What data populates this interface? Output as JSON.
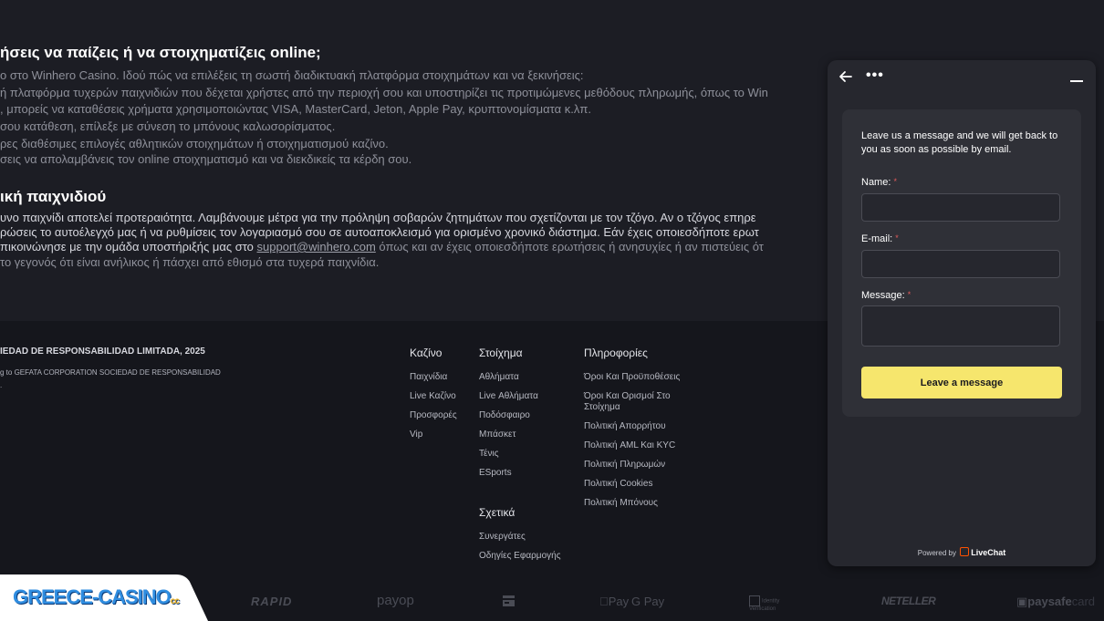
{
  "article": {
    "heading1": "ήσεις να παίζεις ή να στοιχηματίζεις online;",
    "lines1": [
      "ο στο Winhero Casino. Ιδού πώς να επιλέξεις τη σωστή διαδικτυακή πλατφόρμα στοιχημάτων και να ξεκινήσεις:",
      "ή πλατφόρμα τυχερών παιχνιδιών που δέχεται χρήστες από την περιοχή σου και υποστηρίζει τις προτιμώμενες μεθόδους πληρωμής, όπως το Win",
      ", μπορείς να καταθέσεις χρήματα χρησιμοποιώντας VISA, MasterCard, Jeton, Apple Pay, κρυπτονομίσματα κ.λπ.",
      "σου κατάθεση, επίλεξε με σύνεση το μπόνους καλωσορίσματος.",
      "ρες διαθέσιμες επιλογές αθλητικών στοιχημάτων ή στοιχηματισμού καζίνο.",
      "σεις να απολαμβάνεις τον online στοιχηματισμό και να διεκδικείς τα κέρδη σου."
    ],
    "heading2": "ική παιχνιδιού",
    "line2a": "υνο παιχνίδι αποτελεί προτεραιότητα. Λαμβάνουμε μέτρα για την πρόληψη σοβαρών ζητημάτων που σχετίζονται με τον τζόγο. Αν ο τζόγος επηρε",
    "line2b": "ρώσεις το αυτοέλεγχό μας ή να ρυθμίσεις τον λογαριασμό σου σε αυτοαποκλεισμό για ορισμένο χρονικό διάστημα. Εάν έχεις οποιεσδήποτε ερωτ",
    "line2c_pre": "πικοινώνησε με την ομάδα υποστήριξής μας στο ",
    "line2c_link": "support@winhero.com",
    "line2c_post": " όπως και αν έχεις οποιεσδήποτε ερωτήσεις ή ανησυχίες ή αν πιστεύεις ότ",
    "line2d": "το γεγονός ότι είναι ανήλικος ή πάσχει από εθισμό στα τυχερά παιχνίδια."
  },
  "footer": {
    "copyright": "IEDAD DE RESPONSABILIDAD LIMITADA, 2025",
    "owner": "g to GEFATA CORPORATION SOCIEDAD DE RESPONSABILIDAD",
    "owner_tail": ".",
    "columns": {
      "casino": {
        "title": "Καζίνο",
        "items": [
          "Παιχνίδια",
          "Live Καζίνο",
          "Προσφορές",
          "Vip"
        ]
      },
      "betting": {
        "title": "Στοίχημα",
        "items": [
          "Αθλήματα",
          "Live Αθλήματα",
          "Ποδόσφαιρο",
          "Μπάσκετ",
          "Τένις",
          "ESports"
        ]
      },
      "about": {
        "title": "Σχετικά",
        "items": [
          "Συνεργάτες",
          "Οδηγίες Εφαρμογής"
        ]
      },
      "info": {
        "title": "Πληροφορίες",
        "items": [
          "Όροι Και Προϋποθέσεις",
          "Όροι Και Ορισμοί Στο Στοίχημα",
          "Πολιτική Απορρήτου",
          "Πολιτική AML Και KYC",
          "Πολιτική Πληρωμών",
          "Πολιτική Cookies",
          "Πολιτική Μπόνους"
        ]
      }
    }
  },
  "payments": {
    "rapid": "RAPID",
    "payop": "payop",
    "applepay": "Pay",
    "googlepay": "G Pay",
    "identity": "Identity Verification",
    "neteller": "NETELLER",
    "paysafe": "paysafe",
    "paysafe_card": "card"
  },
  "logo": {
    "text": "GREECE-CASINO",
    "suffix": "cc"
  },
  "chat": {
    "intro": "Leave us a message and we will get back to you as soon as possible by email.",
    "name_label": "Name:",
    "email_label": "E-mail:",
    "message_label": "Message:",
    "required_mark": "*",
    "name_value": "",
    "email_value": "",
    "message_value": "",
    "submit_label": "Leave a message",
    "powered_by": "Powered by",
    "brand": "LiveChat",
    "more_glyph": "•••"
  },
  "colors": {
    "accent_button": "#f6e66d",
    "livechat_orange": "#ff5100",
    "required_red": "#e25b5b"
  }
}
